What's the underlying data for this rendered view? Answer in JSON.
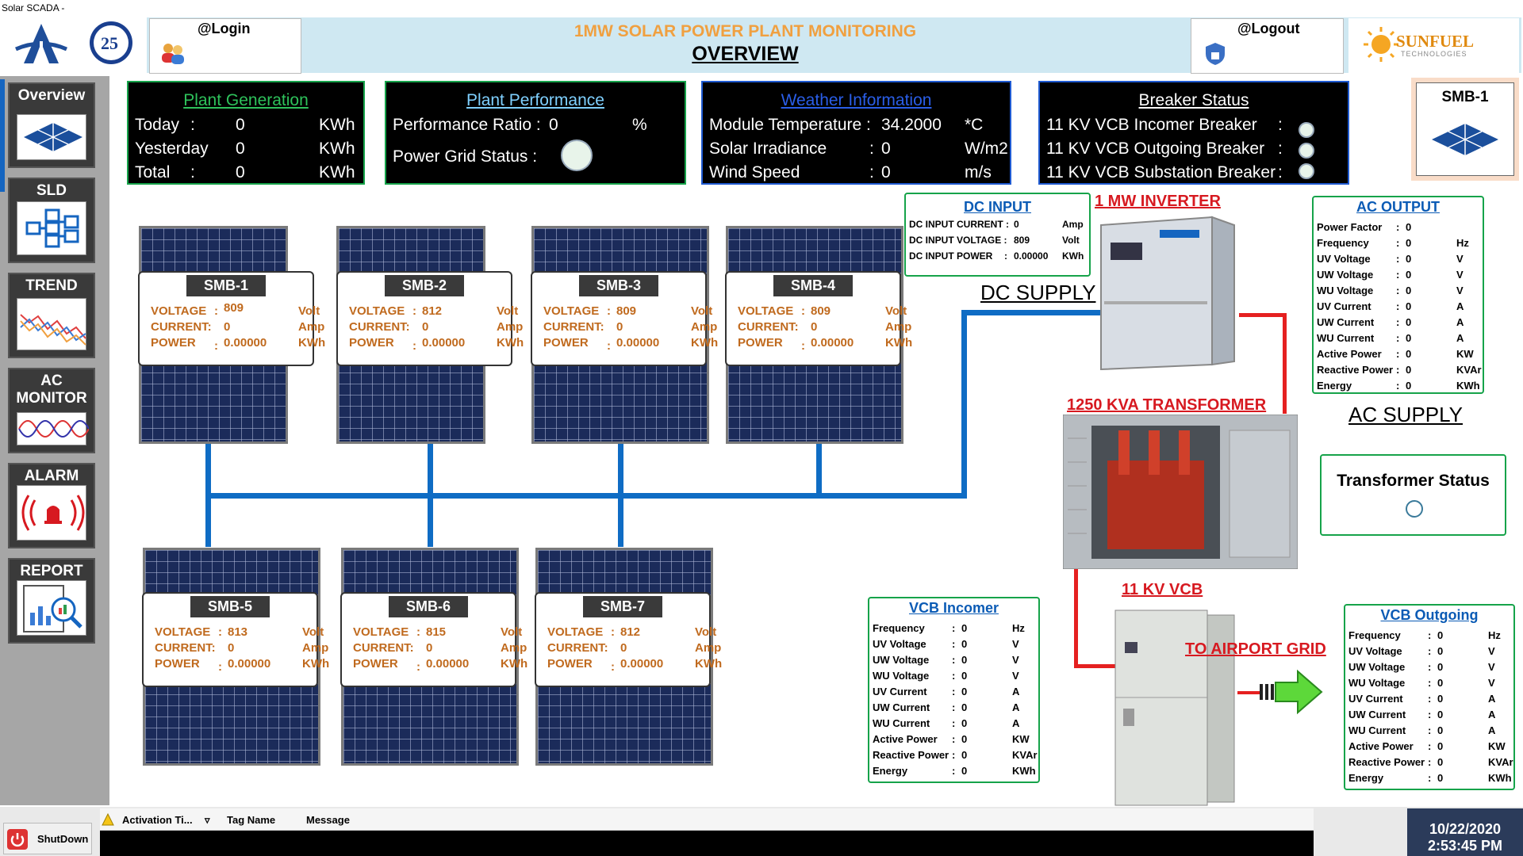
{
  "window_title": "Solar SCADA -",
  "header": {
    "title": "1MW SOLAR POWER PLANT MONITORING",
    "subtitle": "OVERVIEW",
    "login": "@Login",
    "logout": "@Logout",
    "brand": "SUNFUEL",
    "brand_sub": "TECHNOLOGIES"
  },
  "sidebar": {
    "items": [
      {
        "label": "Overview",
        "icon": "solar-panel-icon"
      },
      {
        "label": "SLD",
        "icon": "single-line-diagram-icon"
      },
      {
        "label": "TREND",
        "icon": "trend-chart-icon"
      },
      {
        "label": "AC",
        "label2": "MONITOR",
        "icon": "sine-wave-icon"
      },
      {
        "label": "ALARM",
        "icon": "alarm-bell-icon"
      },
      {
        "label": "REPORT",
        "icon": "report-chart-icon"
      }
    ]
  },
  "plant_generation": {
    "title": "Plant Generation",
    "rows": [
      {
        "label": "Today",
        "sep": ":",
        "value": "0",
        "unit": "KWh"
      },
      {
        "label": "Yesterday",
        "sep": "",
        "value": "0",
        "unit": "KWh"
      },
      {
        "label": "Total",
        "sep": ":",
        "value": "0",
        "unit": "KWh"
      }
    ]
  },
  "plant_performance": {
    "title": "Plant Performance",
    "ratio_label": "Performance Ratio :",
    "ratio_value": "0",
    "ratio_unit": "%",
    "grid_label": "Power Grid Status :"
  },
  "weather": {
    "title": "Weather Information",
    "rows": [
      {
        "label": "Module Temperature :",
        "value": "34.2000",
        "unit": "*C"
      },
      {
        "label": "Solar Irradiance",
        "sep": ":",
        "value": "0",
        "unit": "W/m2"
      },
      {
        "label": "Wind Speed",
        "sep": ":",
        "value": "0",
        "unit": "m/s"
      }
    ]
  },
  "breaker": {
    "title": "Breaker Status",
    "rows": [
      {
        "label": "11 KV VCB Incomer Breaker",
        "sep": ":"
      },
      {
        "label": "11 KV VCB Outgoing Breaker",
        "sep": ":"
      },
      {
        "label": "11 KV VCB Substation Breaker",
        "sep": ":"
      }
    ]
  },
  "smb_selected": "SMB-1",
  "smbs": [
    {
      "name": "SMB-1",
      "voltage": "809",
      "current": "0",
      "power": "0.00000"
    },
    {
      "name": "SMB-2",
      "voltage": "812",
      "current": "0",
      "power": "0.00000"
    },
    {
      "name": "SMB-3",
      "voltage": "809",
      "current": "0",
      "power": "0.00000"
    },
    {
      "name": "SMB-4",
      "voltage": "809",
      "current": "0",
      "power": "0.00000"
    },
    {
      "name": "SMB-5",
      "voltage": "813",
      "current": "0",
      "power": "0.00000"
    },
    {
      "name": "SMB-6",
      "voltage": "815",
      "current": "0",
      "power": "0.00000"
    },
    {
      "name": "SMB-7",
      "voltage": "812",
      "current": "0",
      "power": "0.00000"
    }
  ],
  "smb_labels": {
    "voltage": "VOLTAGE",
    "current": "CURRENT:",
    "power": "POWER",
    "colon": ":",
    "volt_unit": "Volt",
    "amp_unit": "Amp",
    "kwh_unit": "KWh"
  },
  "dc_input": {
    "title": "DC INPUT",
    "rows": [
      {
        "label": "DC INPUT CURRENT :",
        "value": "0",
        "unit": "Amp"
      },
      {
        "label": "DC INPUT VOLTAGE :",
        "value": "809",
        "unit": "Volt"
      },
      {
        "label": "DC INPUT POWER",
        "sep": ":",
        "value": "0.00000",
        "unit": "KWh"
      }
    ]
  },
  "labels": {
    "inverter": "1 MW INVERTER",
    "dc_supply": "DC SUPPLY",
    "transformer": "1250 KVA TRANSFORMER",
    "ac_supply": "AC SUPPLY",
    "vcb": "11 KV VCB",
    "airport": "TO AIRPORT GRID",
    "transformer_status": "Transformer Status"
  },
  "ac_output": {
    "title": "AC OUTPUT",
    "rows": [
      {
        "label": "Power Factor",
        "value": "0",
        "unit": ""
      },
      {
        "label": "Frequency",
        "value": "0",
        "unit": "Hz"
      },
      {
        "label": "UV Voltage",
        "value": "0",
        "unit": "V"
      },
      {
        "label": "UW Voltage",
        "value": "0",
        "unit": "V"
      },
      {
        "label": "WU Voltage",
        "value": "0",
        "unit": "V"
      },
      {
        "label": "UV Current",
        "value": "0",
        "unit": "A"
      },
      {
        "label": "UW Current",
        "value": "0",
        "unit": "A"
      },
      {
        "label": "WU Current",
        "value": "0",
        "unit": "A"
      },
      {
        "label": "Active Power",
        "value": "0",
        "unit": "KW"
      },
      {
        "label": "Reactive Power",
        "value": "0",
        "unit": "KVAr"
      },
      {
        "label": "Energy",
        "value": "0",
        "unit": "KWh"
      }
    ]
  },
  "vcb_incomer": {
    "title": "VCB Incomer",
    "rows": [
      {
        "label": "Frequency",
        "value": "0",
        "unit": "Hz"
      },
      {
        "label": "UV Voltage",
        "value": "0",
        "unit": "V"
      },
      {
        "label": "UW Voltage",
        "value": "0",
        "unit": "V"
      },
      {
        "label": "WU Voltage",
        "value": "0",
        "unit": "V"
      },
      {
        "label": "UV Current",
        "value": "0",
        "unit": "A"
      },
      {
        "label": "UW Current",
        "value": "0",
        "unit": "A"
      },
      {
        "label": "WU Current",
        "value": "0",
        "unit": "A"
      },
      {
        "label": "Active Power",
        "value": "0",
        "unit": "KW"
      },
      {
        "label": "Reactive Power",
        "value": "0",
        "unit": "KVAr"
      },
      {
        "label": "Energy",
        "value": "0",
        "unit": "KWh"
      }
    ]
  },
  "vcb_outgoing": {
    "title": "VCB Outgoing",
    "rows": [
      {
        "label": "Frequency",
        "value": "0",
        "unit": "Hz"
      },
      {
        "label": "UV Voltage",
        "value": "0",
        "unit": "V"
      },
      {
        "label": "UW Voltage",
        "value": "0",
        "unit": "V"
      },
      {
        "label": "WU Voltage",
        "value": "0",
        "unit": "V"
      },
      {
        "label": "UV Current",
        "value": "0",
        "unit": "A"
      },
      {
        "label": "UW Current",
        "value": "0",
        "unit": "A"
      },
      {
        "label": "WU Current",
        "value": "0",
        "unit": "A"
      },
      {
        "label": "Active Power",
        "value": "0",
        "unit": "KW"
      },
      {
        "label": "Reactive Power",
        "value": "0",
        "unit": "KVAr"
      },
      {
        "label": "Energy",
        "value": "0",
        "unit": "KWh"
      }
    ]
  },
  "alarm_table": {
    "columns": [
      "Activation Ti...",
      "Tag Name",
      "Message"
    ]
  },
  "shutdown_label": "ShutDown",
  "datetime": {
    "date": "10/22/2020",
    "time": "2:53:45 PM"
  },
  "colors": {
    "header_title": "#f0a040",
    "panel_border": "#16a34a",
    "wire_dc": "#0f6cc4",
    "wire_ac": "#e52020",
    "label_red": "#d71920",
    "link_blue": "#0b5bb5"
  }
}
